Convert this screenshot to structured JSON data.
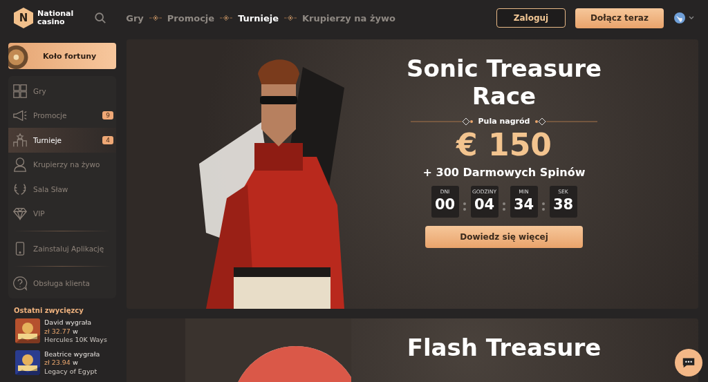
{
  "header": {
    "logo_letter": "N",
    "logo_text": [
      "National",
      "casino"
    ],
    "nav": [
      {
        "label": "Gry",
        "selected": false
      },
      {
        "label": "Promocje",
        "selected": false
      },
      {
        "label": "Turnieje",
        "selected": true
      },
      {
        "label": "Krupierzy na żywo",
        "selected": false
      }
    ],
    "login": "Zaloguj",
    "join": "Dołącz teraz"
  },
  "sidebar": {
    "wheel": "Koło fortuny",
    "items": [
      {
        "kind": "games",
        "label": "Gry",
        "selected": false
      },
      {
        "kind": "megaphone",
        "label": "Promocje",
        "badge": "9",
        "selected": false
      },
      {
        "kind": "podium",
        "label": "Turnieje",
        "badge": "4",
        "selected": true
      },
      {
        "kind": "dealer",
        "label": "Krupierzy na żywo",
        "selected": false
      },
      {
        "kind": "laurel",
        "label": "Sala Sław",
        "selected": false
      },
      {
        "kind": "diamond",
        "label": "VIP",
        "selected": false
      }
    ],
    "app": "Zainstaluj Aplikację",
    "support": "Obsługa klienta",
    "winners_title": "Ostatni zwycięzcy",
    "winners": [
      {
        "name": "David wygrała",
        "amount": "zł 32.77",
        "w": "w",
        "game": "Hercules 10K Ways",
        "color": "#b5512e"
      },
      {
        "name": "Beatrice wygrała",
        "amount": "zł 23.94",
        "w": "w",
        "game": "Legacy of Egypt",
        "color": "#2a3c8f"
      }
    ]
  },
  "tournaments": [
    {
      "title": "Sonic Treasure Race",
      "pool_label": "Pula nagród",
      "prize": "€ 150",
      "extra": "+ 300 Darmowych Spinów",
      "countdown": [
        {
          "label": "DNI",
          "value": "00"
        },
        {
          "label": "GODZINY",
          "value": "04"
        },
        {
          "label": "MIN",
          "value": "34"
        },
        {
          "label": "SEK",
          "value": "38"
        }
      ],
      "button": "Dowiedz się więcej"
    },
    {
      "title": "Flash Treasure"
    }
  ]
}
